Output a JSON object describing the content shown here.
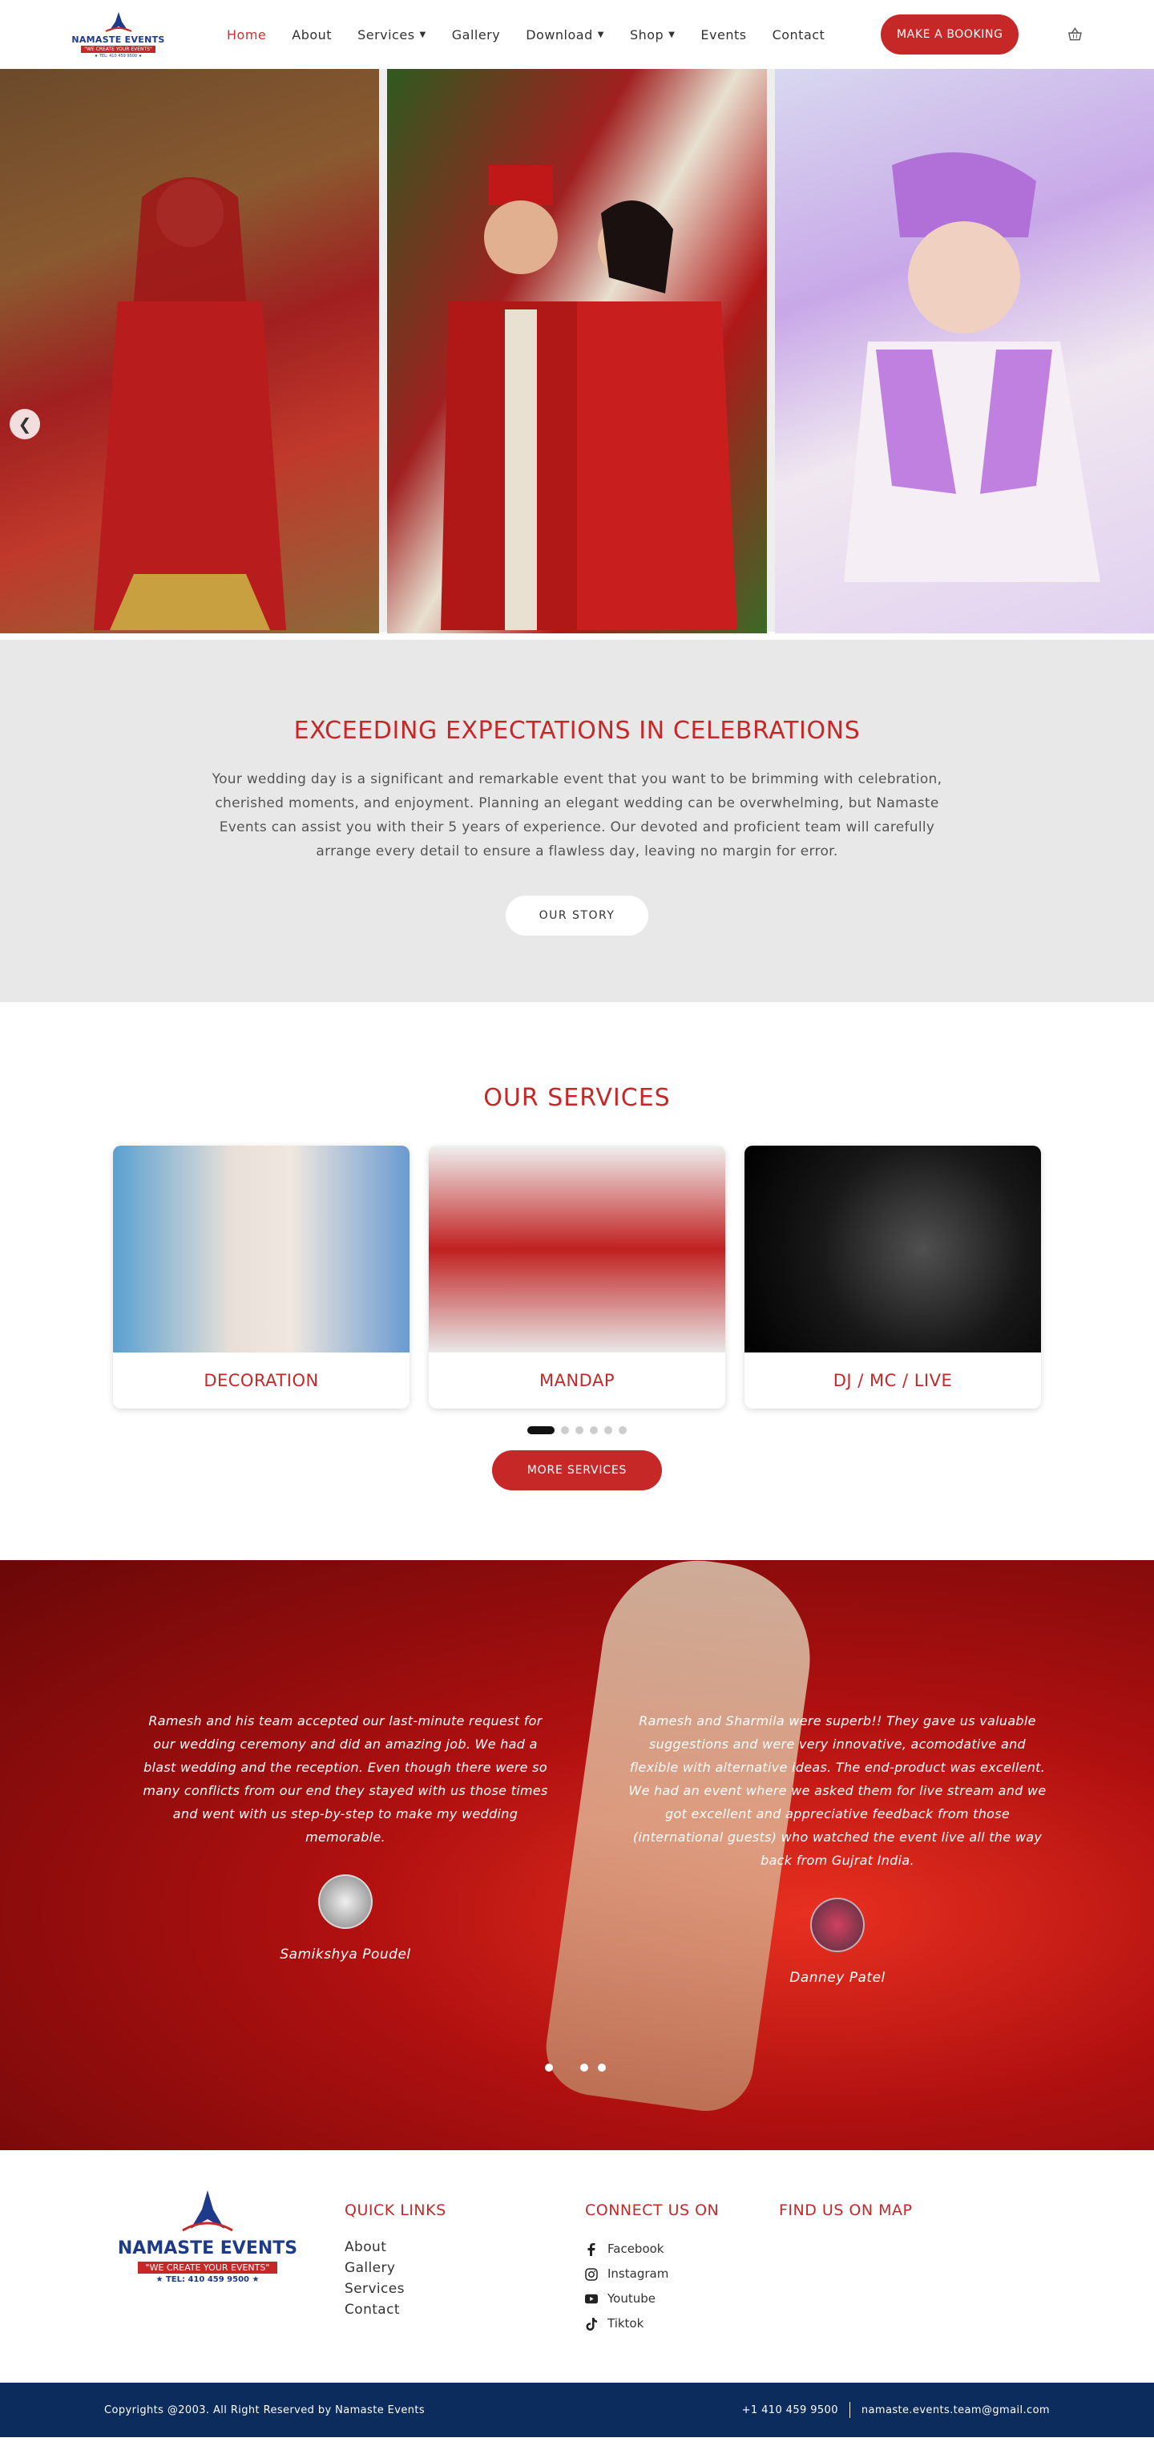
{
  "header": {
    "logo": {
      "brand": "NAMASTE EVENTS",
      "tagline": "\"WE CREATE YOUR EVENTS\"",
      "tel": "★ TEL: 410 459 9500 ★"
    },
    "nav": [
      {
        "label": "Home",
        "active": true,
        "dropdown": false
      },
      {
        "label": "About",
        "active": false,
        "dropdown": false
      },
      {
        "label": "Services",
        "active": false,
        "dropdown": true
      },
      {
        "label": "Gallery",
        "active": false,
        "dropdown": false
      },
      {
        "label": "Download",
        "active": false,
        "dropdown": true
      },
      {
        "label": "Shop",
        "active": false,
        "dropdown": true
      },
      {
        "label": "Events",
        "active": false,
        "dropdown": false
      },
      {
        "label": "Contact",
        "active": false,
        "dropdown": false
      }
    ],
    "book_button": "MAKE A BOOKING",
    "cart_icon": "basket-icon"
  },
  "intro": {
    "title": "EXCEEDING EXPECTATIONS IN CELEBRATIONS",
    "body": "Your wedding day is a significant and remarkable event that you want to be brimming with celebration, cherished moments, and enjoyment. Planning an elegant wedding can be overwhelming, but Namaste Events can assist you with their 5 years of experience. Our devoted and proficient team will carefully arrange every detail to ensure a flawless day, leaving no margin for error.",
    "button": "OUR STORY"
  },
  "services": {
    "title": "OUR SERVICES",
    "cards": [
      {
        "label": "DECORATION"
      },
      {
        "label": "MANDAP"
      },
      {
        "label": "DJ / MC / LIVE"
      }
    ],
    "button": "MORE SERVICES"
  },
  "testimonials": [
    {
      "text": "Ramesh and his team accepted our last-minute request for our wedding ceremony and did an amazing job. We had a blast wedding and the reception. Even though there were so many conflicts from our end they stayed with us those times and went with us step-by-step to make my wedding memorable.",
      "name": "Samikshya Poudel"
    },
    {
      "text": "Ramesh and Sharmila were superb!! They gave us valuable suggestions and were very innovative, acomodative and flexible with alternative ideas. The end-product was excellent. We had an event where we asked them for live stream and we got excellent and appreciative feedback from those (international guests) who watched the event live all the way back from Gujrat India.",
      "name": "Danney Patel"
    }
  ],
  "footer": {
    "logo": {
      "brand": "NAMASTE EVENTS",
      "tagline": "\"WE CREATE YOUR EVENTS\"",
      "tel": "★ TEL: 410 459 9500 ★"
    },
    "quick_links_title": "QUICK LINKS",
    "quick_links": [
      "About",
      "Gallery",
      "Services",
      "Contact"
    ],
    "connect_title": "CONNECT US ON",
    "social": [
      {
        "label": "Facebook",
        "icon": "facebook-icon"
      },
      {
        "label": "Instagram",
        "icon": "instagram-icon"
      },
      {
        "label": "Youtube",
        "icon": "youtube-icon"
      },
      {
        "label": "Tiktok",
        "icon": "tiktok-icon"
      }
    ],
    "map_title": "FIND US ON MAP"
  },
  "copyright": {
    "text": "Copyrights @2003. All Right Reserved by Namaste Events",
    "phone": "+1 410 459 9500",
    "email": "namaste.events.team@gmail.com"
  },
  "colors": {
    "accent": "#c62828",
    "footer_bar": "#0d2c5e",
    "intro_bg": "#e8e8e8"
  }
}
